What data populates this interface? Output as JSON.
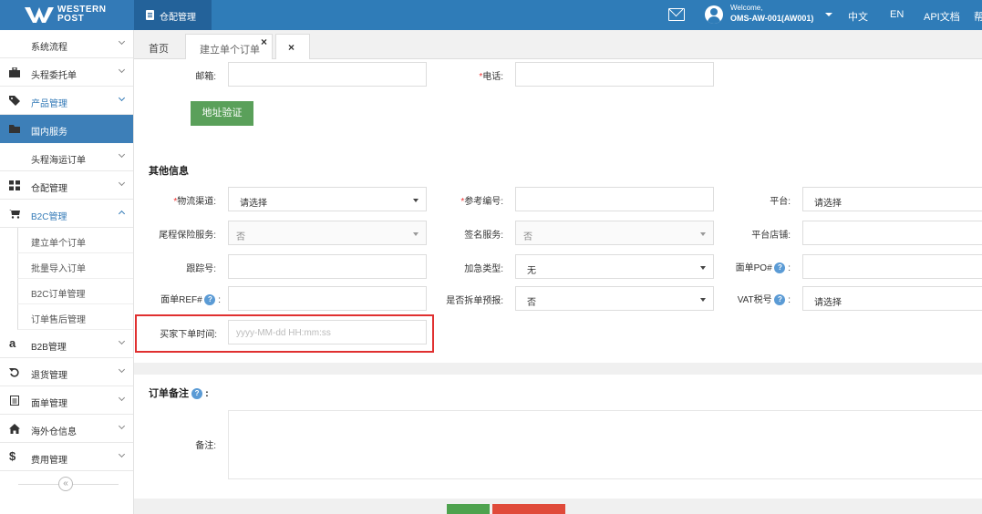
{
  "header": {
    "logo_line1": "WESTERN",
    "logo_line2": "POST",
    "module_tab": "仓配管理",
    "welcome": "Welcome,",
    "account": "OMS-AW-001(AW001)",
    "lang_cn": "中文",
    "lang_en": "EN",
    "api_doc": "API文档",
    "help_cut": "帮"
  },
  "sidebar": {
    "items": [
      {
        "label": "系统流程",
        "icon": "none"
      },
      {
        "label": "头程委托单",
        "icon": "briefcase-icon"
      },
      {
        "label": "产品管理",
        "icon": "tag-icon"
      },
      {
        "label": "国内服务",
        "icon": "folder-icon"
      },
      {
        "label": "头程海运订单",
        "icon": "none"
      },
      {
        "label": "仓配管理",
        "icon": "grid-icon"
      },
      {
        "label": "B2C管理",
        "icon": "cart-icon"
      },
      {
        "label": "B2B管理",
        "icon": "amazon-icon"
      },
      {
        "label": "退货管理",
        "icon": "return-icon"
      },
      {
        "label": "面单管理",
        "icon": "document-icon"
      },
      {
        "label": "海外仓信息",
        "icon": "home-icon"
      },
      {
        "label": "费用管理",
        "icon": "dollar-icon"
      }
    ],
    "b2c_sub": [
      "建立单个订单",
      "批量导入订单",
      "B2C订单管理",
      "订单售后管理"
    ],
    "collapse": "«"
  },
  "tabs": {
    "home": "首页",
    "active": "建立单个订单",
    "close_x": "×",
    "close_all": "×"
  },
  "address": {
    "email_label": "邮箱:",
    "email_value": "",
    "phone_label": "电话:",
    "phone_value": "",
    "verify_button": "地址验证"
  },
  "other_info": {
    "title": "其他信息",
    "logistics_label": "物流渠道:",
    "logistics_value": "请选择",
    "reference_label": "参考编号:",
    "reference_value": "",
    "platform_label": "平台:",
    "platform_value": "请选择",
    "tail_insurance_label": "尾程保险服务:",
    "tail_insurance_value": "否",
    "signature_label": "签名服务:",
    "signature_value": "否",
    "store_label": "平台店铺:",
    "store_value": "",
    "tracking_label": "跟踪号:",
    "tracking_value": "",
    "urgent_label": "加急类型:",
    "urgent_value": "无",
    "waybill_po_label": "面单PO#",
    "waybill_po_value": "",
    "waybill_ref_label": "面单REF#",
    "waybill_ref_value": "",
    "split_label": "是否拆单预报:",
    "split_value": "否",
    "vat_label": "VAT税号",
    "vat_value": "请选择",
    "buyer_time_label": "买家下单时间:",
    "buyer_time_placeholder": "yyyy-MM-dd HH:mm:ss",
    "colon": ":"
  },
  "remark": {
    "title": "订单备注",
    "title_colon": ":",
    "label": "备注:",
    "value": ""
  },
  "help_glyph": "?",
  "colors": {
    "topbar": "#2f7cb8",
    "active_menu": "#3d7fb8",
    "green_button": "#5aa05a",
    "highlight": "#e03030"
  }
}
